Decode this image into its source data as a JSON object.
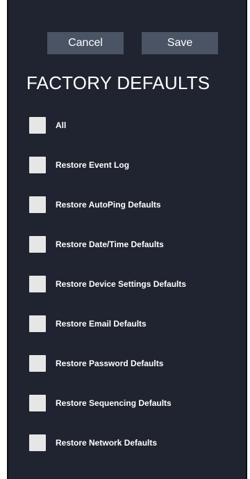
{
  "buttons": {
    "cancel": "Cancel",
    "save": "Save"
  },
  "title": "FACTORY DEFAULTS",
  "options": [
    {
      "label": "All",
      "checked": false
    },
    {
      "label": "Restore Event Log",
      "checked": false
    },
    {
      "label": "Restore AutoPing Defaults",
      "checked": false
    },
    {
      "label": "Restore Date/Time Defaults",
      "checked": false
    },
    {
      "label": "Restore Device Settings Defaults",
      "checked": false
    },
    {
      "label": "Restore Email Defaults",
      "checked": false
    },
    {
      "label": "Restore Password Defaults",
      "checked": false
    },
    {
      "label": "Restore Sequencing Defaults",
      "checked": false
    },
    {
      "label": "Restore Network Defaults",
      "checked": false
    }
  ],
  "colors": {
    "panel": "#1f2430",
    "button": "#4a5465",
    "checkbox": "#e6e6e6",
    "text": "#ffffff"
  }
}
